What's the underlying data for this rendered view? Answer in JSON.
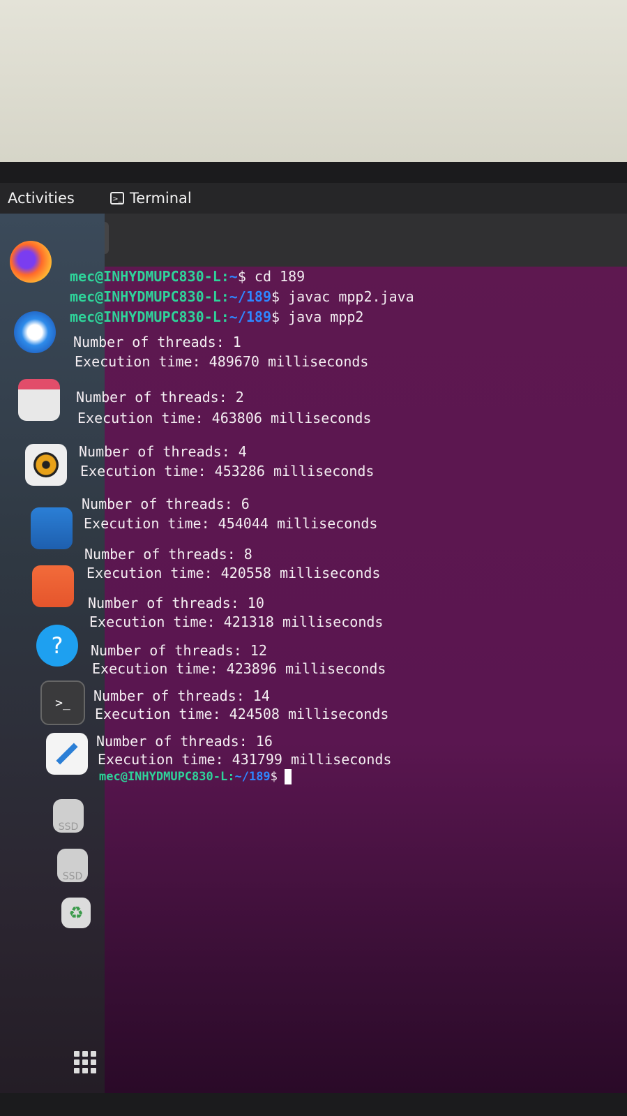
{
  "topbar": {
    "activities": "Activities",
    "app_name": "Terminal"
  },
  "dock": {
    "items": [
      {
        "name": "firefox",
        "icon": "firefox-icon"
      },
      {
        "name": "thunderbird",
        "icon": "mail-icon"
      },
      {
        "name": "files",
        "icon": "folder-icon"
      },
      {
        "name": "rhythmbox",
        "icon": "speaker-icon"
      },
      {
        "name": "libreoffice-writer",
        "icon": "document-icon"
      },
      {
        "name": "app-center",
        "icon": "store-icon"
      },
      {
        "name": "help",
        "icon": "help-icon",
        "glyph": "?"
      },
      {
        "name": "terminal",
        "icon": "terminal-icon",
        "glyph": ">_"
      },
      {
        "name": "text-editor",
        "icon": "pencil-icon"
      },
      {
        "name": "ssd-1",
        "icon": "drive-icon",
        "label": "SSD"
      },
      {
        "name": "ssd-2",
        "icon": "drive-icon",
        "label": "SSD"
      },
      {
        "name": "trash",
        "icon": "trash-icon",
        "glyph": "♻"
      }
    ]
  },
  "terminal": {
    "prompt_user": "mec@INHYDMUPC830-L",
    "commands": [
      {
        "path": "~",
        "cmd": " cd 189"
      },
      {
        "path": "~/189",
        "cmd": " javac mpp2.java"
      },
      {
        "path": "~/189",
        "cmd": " java mpp2"
      }
    ],
    "results": [
      {
        "threads": "Number of threads: 1",
        "time": "Execution time: 489670 milliseconds"
      },
      {
        "threads": "Number of threads: 2",
        "time": "Execution time: 463806 milliseconds"
      },
      {
        "threads": "Number of threads: 4",
        "time": "Execution time: 453286 milliseconds"
      },
      {
        "threads": "Number of threads: 6",
        "time": "Execution time: 454044 milliseconds"
      },
      {
        "threads": "Number of threads: 8",
        "time": "Execution time: 420558 milliseconds"
      },
      {
        "threads": "Number of threads: 10",
        "time": "Execution time: 421318 milliseconds"
      },
      {
        "threads": "Number of threads: 12",
        "time": "Execution time: 423896 milliseconds"
      },
      {
        "threads": "Number of threads: 14",
        "time": "Execution time: 424508 milliseconds"
      },
      {
        "threads": "Number of threads: 16",
        "time": "Execution time: 431799 milliseconds"
      }
    ],
    "final_prompt_path": "~/189",
    "dollar": "$",
    "colon": ":"
  }
}
